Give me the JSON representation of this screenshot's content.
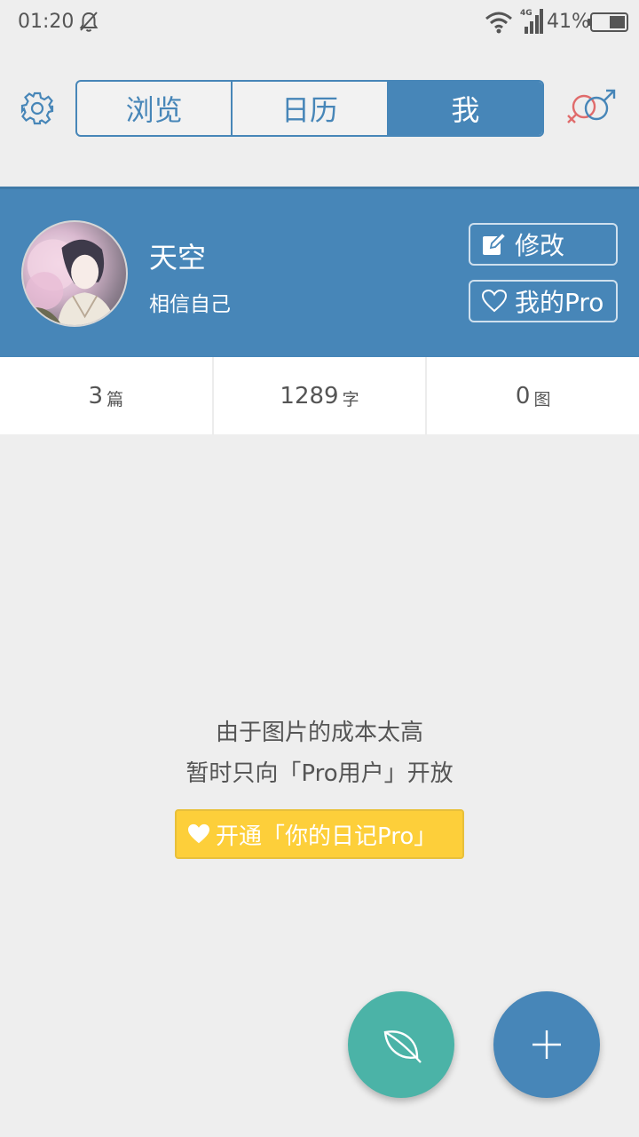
{
  "status_bar": {
    "time": "01:20",
    "battery": "41%",
    "network": "4G"
  },
  "header": {
    "tabs": [
      {
        "label": "浏览",
        "active": false
      },
      {
        "label": "日历",
        "active": false
      },
      {
        "label": "我",
        "active": true
      }
    ]
  },
  "profile": {
    "name": "天空",
    "motto": "相信自己",
    "edit_label": "修改",
    "pro_label": "我的Pro"
  },
  "stats": [
    {
      "value": "3",
      "unit": "篇"
    },
    {
      "value": "1289",
      "unit": "字"
    },
    {
      "value": "0",
      "unit": "图"
    }
  ],
  "notice": {
    "line1": "由于图片的成本太高",
    "line2": "暂时只向「Pro用户」开放",
    "button_label": "开通「你的日记Pro」"
  },
  "colors": {
    "primary": "#4786b8",
    "teal": "#4bb3a7",
    "yellow": "#fdcf3a",
    "background": "#eeeeee"
  },
  "icons": [
    "gear-icon",
    "gender-icon",
    "edit-icon",
    "heart-icon",
    "leaf-icon",
    "plus-icon"
  ]
}
